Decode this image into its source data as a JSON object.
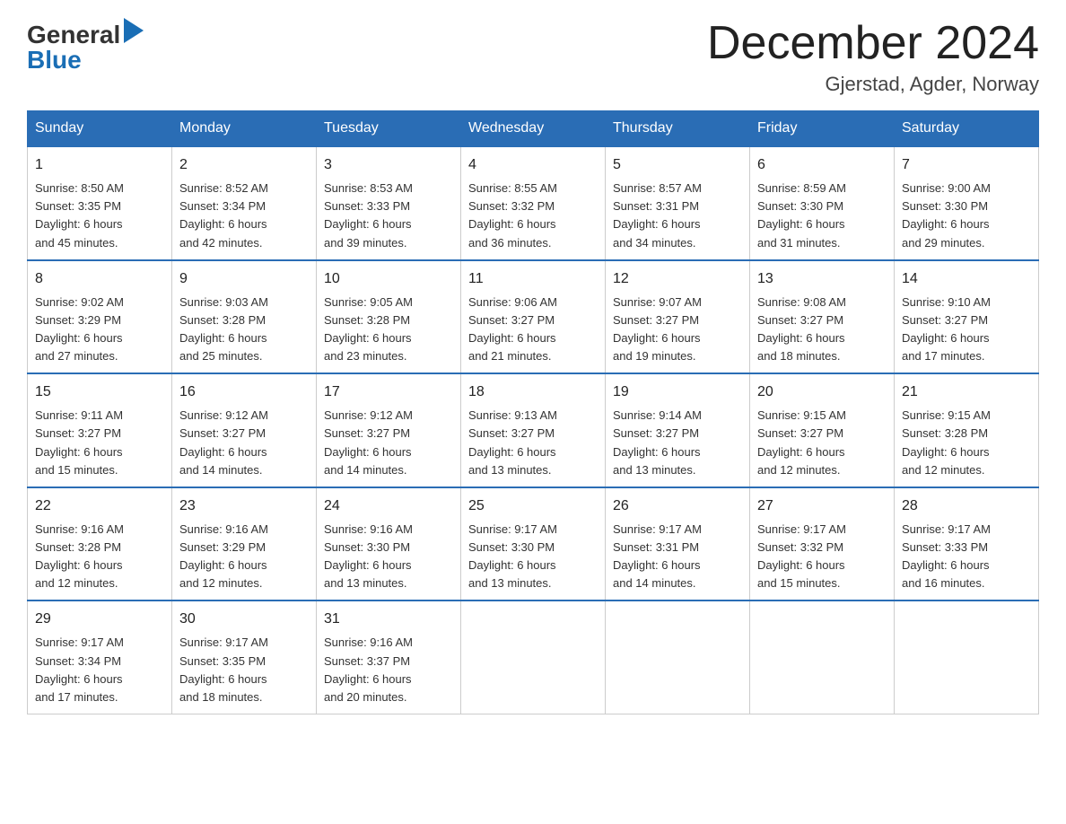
{
  "logo": {
    "general": "General",
    "blue": "Blue"
  },
  "header": {
    "title": "December 2024",
    "location": "Gjerstad, Agder, Norway"
  },
  "days_of_week": [
    "Sunday",
    "Monday",
    "Tuesday",
    "Wednesday",
    "Thursday",
    "Friday",
    "Saturday"
  ],
  "weeks": [
    [
      {
        "day": "1",
        "sunrise": "8:50 AM",
        "sunset": "3:35 PM",
        "daylight": "6 hours and 45 minutes."
      },
      {
        "day": "2",
        "sunrise": "8:52 AM",
        "sunset": "3:34 PM",
        "daylight": "6 hours and 42 minutes."
      },
      {
        "day": "3",
        "sunrise": "8:53 AM",
        "sunset": "3:33 PM",
        "daylight": "6 hours and 39 minutes."
      },
      {
        "day": "4",
        "sunrise": "8:55 AM",
        "sunset": "3:32 PM",
        "daylight": "6 hours and 36 minutes."
      },
      {
        "day": "5",
        "sunrise": "8:57 AM",
        "sunset": "3:31 PM",
        "daylight": "6 hours and 34 minutes."
      },
      {
        "day": "6",
        "sunrise": "8:59 AM",
        "sunset": "3:30 PM",
        "daylight": "6 hours and 31 minutes."
      },
      {
        "day": "7",
        "sunrise": "9:00 AM",
        "sunset": "3:30 PM",
        "daylight": "6 hours and 29 minutes."
      }
    ],
    [
      {
        "day": "8",
        "sunrise": "9:02 AM",
        "sunset": "3:29 PM",
        "daylight": "6 hours and 27 minutes."
      },
      {
        "day": "9",
        "sunrise": "9:03 AM",
        "sunset": "3:28 PM",
        "daylight": "6 hours and 25 minutes."
      },
      {
        "day": "10",
        "sunrise": "9:05 AM",
        "sunset": "3:28 PM",
        "daylight": "6 hours and 23 minutes."
      },
      {
        "day": "11",
        "sunrise": "9:06 AM",
        "sunset": "3:27 PM",
        "daylight": "6 hours and 21 minutes."
      },
      {
        "day": "12",
        "sunrise": "9:07 AM",
        "sunset": "3:27 PM",
        "daylight": "6 hours and 19 minutes."
      },
      {
        "day": "13",
        "sunrise": "9:08 AM",
        "sunset": "3:27 PM",
        "daylight": "6 hours and 18 minutes."
      },
      {
        "day": "14",
        "sunrise": "9:10 AM",
        "sunset": "3:27 PM",
        "daylight": "6 hours and 17 minutes."
      }
    ],
    [
      {
        "day": "15",
        "sunrise": "9:11 AM",
        "sunset": "3:27 PM",
        "daylight": "6 hours and 15 minutes."
      },
      {
        "day": "16",
        "sunrise": "9:12 AM",
        "sunset": "3:27 PM",
        "daylight": "6 hours and 14 minutes."
      },
      {
        "day": "17",
        "sunrise": "9:12 AM",
        "sunset": "3:27 PM",
        "daylight": "6 hours and 14 minutes."
      },
      {
        "day": "18",
        "sunrise": "9:13 AM",
        "sunset": "3:27 PM",
        "daylight": "6 hours and 13 minutes."
      },
      {
        "day": "19",
        "sunrise": "9:14 AM",
        "sunset": "3:27 PM",
        "daylight": "6 hours and 13 minutes."
      },
      {
        "day": "20",
        "sunrise": "9:15 AM",
        "sunset": "3:27 PM",
        "daylight": "6 hours and 12 minutes."
      },
      {
        "day": "21",
        "sunrise": "9:15 AM",
        "sunset": "3:28 PM",
        "daylight": "6 hours and 12 minutes."
      }
    ],
    [
      {
        "day": "22",
        "sunrise": "9:16 AM",
        "sunset": "3:28 PM",
        "daylight": "6 hours and 12 minutes."
      },
      {
        "day": "23",
        "sunrise": "9:16 AM",
        "sunset": "3:29 PM",
        "daylight": "6 hours and 12 minutes."
      },
      {
        "day": "24",
        "sunrise": "9:16 AM",
        "sunset": "3:30 PM",
        "daylight": "6 hours and 13 minutes."
      },
      {
        "day": "25",
        "sunrise": "9:17 AM",
        "sunset": "3:30 PM",
        "daylight": "6 hours and 13 minutes."
      },
      {
        "day": "26",
        "sunrise": "9:17 AM",
        "sunset": "3:31 PM",
        "daylight": "6 hours and 14 minutes."
      },
      {
        "day": "27",
        "sunrise": "9:17 AM",
        "sunset": "3:32 PM",
        "daylight": "6 hours and 15 minutes."
      },
      {
        "day": "28",
        "sunrise": "9:17 AM",
        "sunset": "3:33 PM",
        "daylight": "6 hours and 16 minutes."
      }
    ],
    [
      {
        "day": "29",
        "sunrise": "9:17 AM",
        "sunset": "3:34 PM",
        "daylight": "6 hours and 17 minutes."
      },
      {
        "day": "30",
        "sunrise": "9:17 AM",
        "sunset": "3:35 PM",
        "daylight": "6 hours and 18 minutes."
      },
      {
        "day": "31",
        "sunrise": "9:16 AM",
        "sunset": "3:37 PM",
        "daylight": "6 hours and 20 minutes."
      },
      null,
      null,
      null,
      null
    ]
  ],
  "labels": {
    "sunrise": "Sunrise:",
    "sunset": "Sunset:",
    "daylight": "Daylight:"
  }
}
